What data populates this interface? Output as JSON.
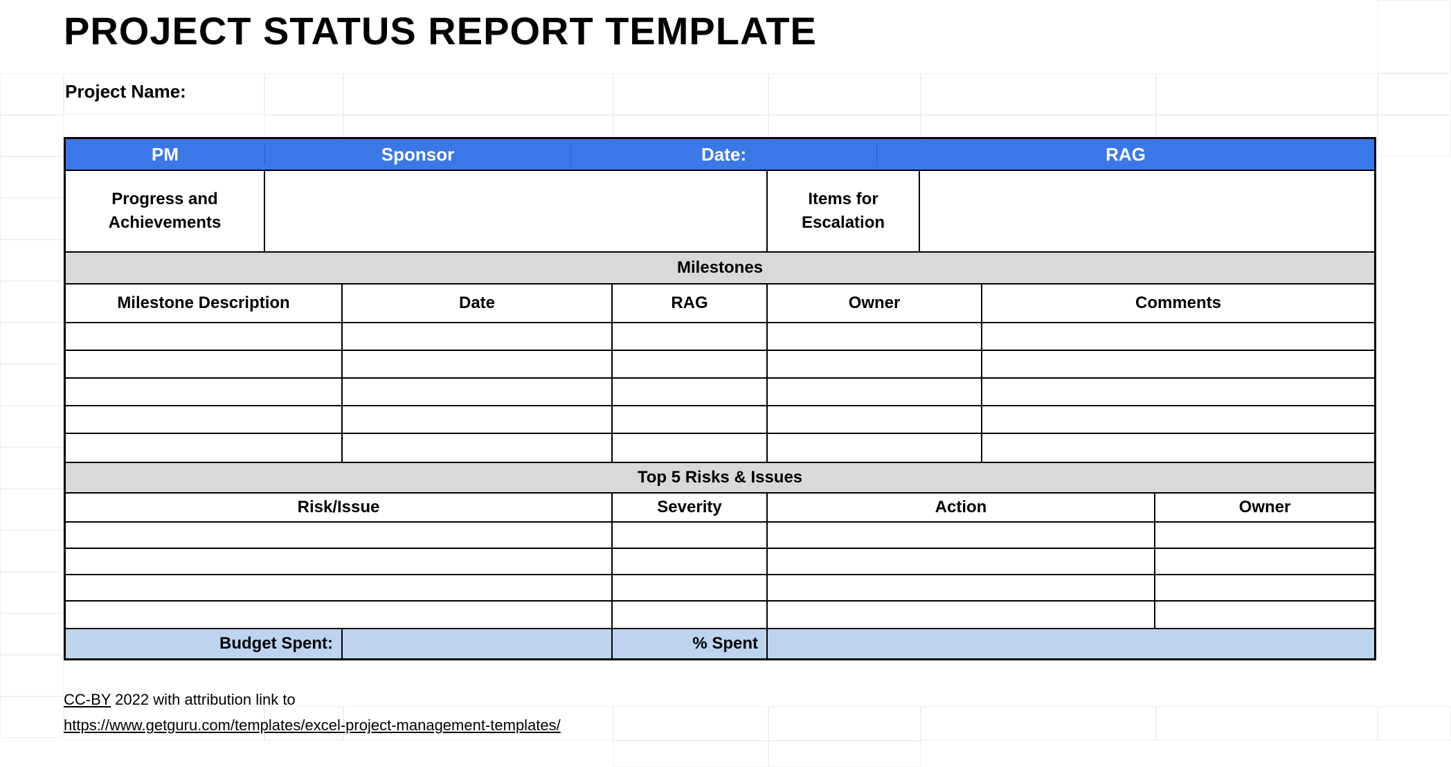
{
  "title": "PROJECT STATUS REPORT TEMPLATE",
  "labels": {
    "project_name": "Project  Name:"
  },
  "header": {
    "pm": "PM",
    "sponsor": "Sponsor",
    "date": "Date:",
    "rag": "RAG"
  },
  "progress": {
    "progress_label": "Progress and Achievements",
    "items_label": "Items for Escalation"
  },
  "milestones": {
    "section_title": "Milestones",
    "columns": {
      "description": "Milestone Description",
      "date": "Date",
      "rag": "RAG",
      "owner": "Owner",
      "comments": "Comments"
    },
    "rows": [
      {
        "description": "",
        "date": "",
        "rag": "",
        "owner": "",
        "comments": ""
      },
      {
        "description": "",
        "date": "",
        "rag": "",
        "owner": "",
        "comments": ""
      },
      {
        "description": "",
        "date": "",
        "rag": "",
        "owner": "",
        "comments": ""
      },
      {
        "description": "",
        "date": "",
        "rag": "",
        "owner": "",
        "comments": ""
      },
      {
        "description": "",
        "date": "",
        "rag": "",
        "owner": "",
        "comments": ""
      }
    ]
  },
  "risks": {
    "section_title": "Top 5 Risks & Issues",
    "columns": {
      "risk_issue": "Risk/Issue",
      "severity": "Severity",
      "action": "Action",
      "owner": "Owner"
    },
    "rows": [
      {
        "risk_issue": "",
        "severity": "",
        "action": "",
        "owner": ""
      },
      {
        "risk_issue": "",
        "severity": "",
        "action": "",
        "owner": ""
      },
      {
        "risk_issue": "",
        "severity": "",
        "action": "",
        "owner": ""
      },
      {
        "risk_issue": "",
        "severity": "",
        "action": "",
        "owner": ""
      }
    ]
  },
  "budget": {
    "spent_label": "Budget Spent:",
    "pct_label": "% Spent"
  },
  "attribution": {
    "license_prefix": "CC-BY",
    "license_rest": " 2022 with attribution link to",
    "link": "https://www.getguru.com/templates/excel-project-management-templates/"
  }
}
